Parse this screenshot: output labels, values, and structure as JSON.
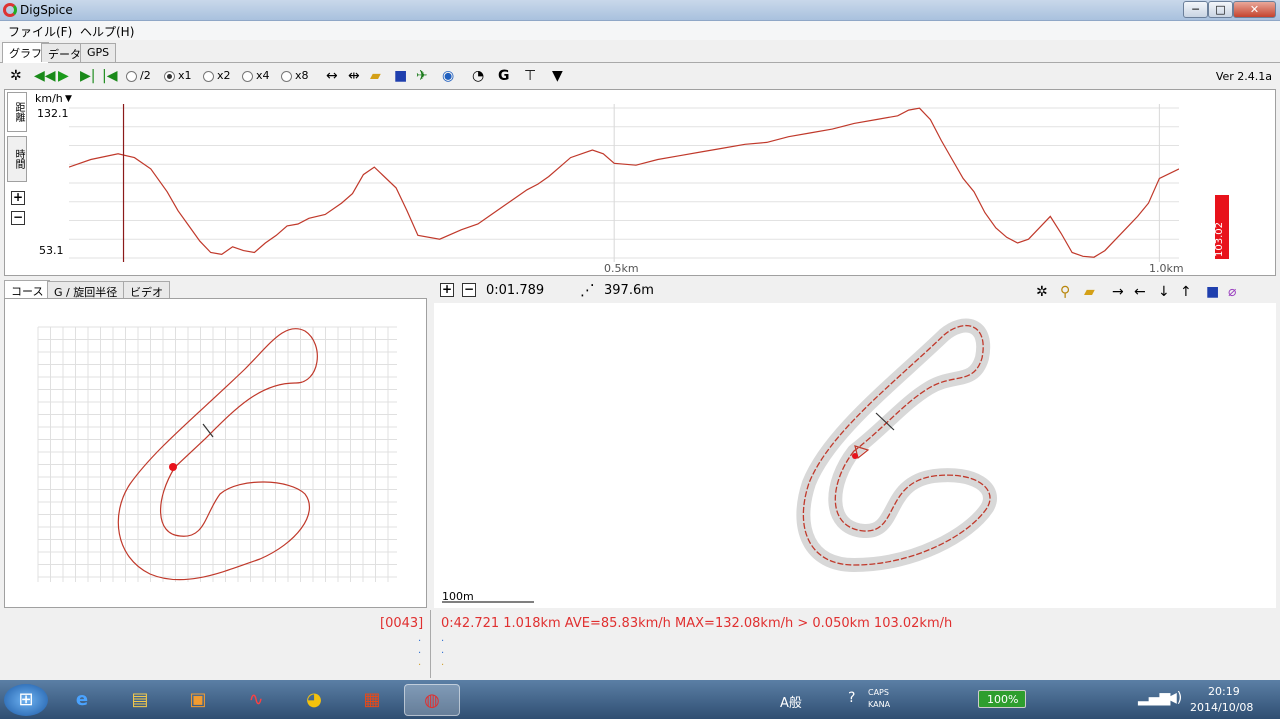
{
  "window": {
    "title": "DigSpice",
    "min": "─",
    "max": "□",
    "close": "✕"
  },
  "menu": {
    "file": "ファイル(F)",
    "help": "ヘルプ(H)"
  },
  "main_tabs": {
    "graph": "グラフ",
    "data": "データ",
    "gps": "GPS"
  },
  "toolbar": {
    "speed_options": {
      "half": "/2",
      "x1": "x1",
      "x2": "x2",
      "x4": "x4",
      "x8": "x8"
    },
    "selected_speed": "x1",
    "version": "Ver 2.4.1a",
    "g_label": "G"
  },
  "graph": {
    "unit": "km/h",
    "unit_arrow": "▼",
    "side_tabs": {
      "distance": "距離",
      "time": "時間"
    },
    "current_value": "103.02",
    "current_fraction": 0.66
  },
  "chart_data": {
    "type": "line",
    "xlabel": "",
    "ylabel": "km/h",
    "xlim": [
      0,
      1.018
    ],
    "ylim": [
      53.1,
      132.1
    ],
    "tick_labels": {
      "y_top": "132.1",
      "y_bottom": "53.1",
      "x_mid": "0.5km",
      "x_end": "1.0km"
    },
    "cursor_x": 0.05,
    "series": [
      {
        "color": "#c0392b",
        "x": [
          0,
          0.02,
          0.045,
          0.06,
          0.075,
          0.09,
          0.1,
          0.11,
          0.12,
          0.13,
          0.14,
          0.15,
          0.16,
          0.17,
          0.18,
          0.19,
          0.2,
          0.21,
          0.22,
          0.235,
          0.25,
          0.26,
          0.27,
          0.28,
          0.3,
          0.31,
          0.32,
          0.34,
          0.36,
          0.375,
          0.385,
          0.4,
          0.41,
          0.42,
          0.43,
          0.44,
          0.45,
          0.46,
          0.47,
          0.48,
          0.49,
          0.5,
          0.52,
          0.54,
          0.56,
          0.58,
          0.6,
          0.62,
          0.64,
          0.66,
          0.68,
          0.7,
          0.72,
          0.74,
          0.76,
          0.77,
          0.78,
          0.79,
          0.8,
          0.81,
          0.82,
          0.83,
          0.84,
          0.85,
          0.86,
          0.87,
          0.88,
          0.89,
          0.9,
          0.91,
          0.92,
          0.93,
          0.94,
          0.95,
          0.96,
          0.97,
          0.98,
          0.99,
          1.0,
          1.018
        ],
        "y": [
          101,
          105,
          108,
          106,
          100,
          88,
          78,
          70,
          62,
          56,
          55,
          59,
          57,
          56,
          61,
          65,
          70,
          71,
          74,
          76,
          82,
          87,
          97,
          101,
          90,
          78,
          65,
          63,
          68,
          71,
          75,
          81,
          85,
          89,
          92,
          96,
          101,
          106,
          108,
          110,
          108,
          103,
          102,
          105,
          107,
          109,
          111,
          113,
          114,
          117,
          119,
          121,
          124,
          126,
          128,
          131,
          132,
          126,
          115,
          105,
          95,
          88,
          77,
          69,
          64,
          61,
          63,
          69,
          75,
          66,
          56,
          54,
          53.5,
          57,
          63,
          69,
          75,
          82,
          95,
          100
        ]
      }
    ]
  },
  "course_tabs": {
    "course": "コース",
    "g_radius": "G / 旋回半径",
    "video": "ビデオ"
  },
  "map_toolbar": {
    "time": "0:01.789",
    "distance": "397.6m",
    "arrows": {
      "right": "→",
      "left": "←",
      "down": "↓",
      "up": "↑"
    }
  },
  "map": {
    "scale_label": "100m"
  },
  "status": {
    "index": "[0043]",
    "lap_info": "0:42.721 1.018km AVE=85.83km/h MAX=132.08km/h > 0.050km 103.02km/h"
  },
  "taskbar": {
    "clock_time": "20:19",
    "clock_date": "2014/10/08",
    "battery": "100%",
    "ime_label": "A般",
    "caps": "CAPS",
    "kana": "KANA"
  },
  "colors": {
    "trace": "#c0392b",
    "indicator": "#e8121b",
    "status_text": "#e03030",
    "track": "#d8d8d8"
  }
}
